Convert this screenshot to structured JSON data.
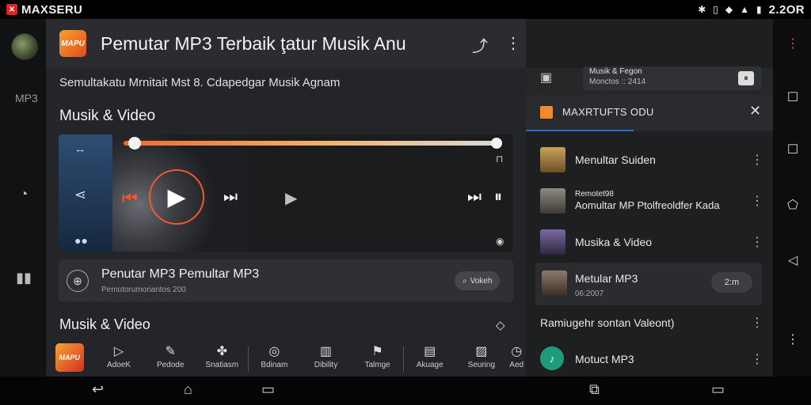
{
  "statusbar": {
    "app_name": "MAXSERU",
    "time": "2.2OR",
    "icons": [
      "bluetooth-icon",
      "vibrate-icon",
      "wifi-icon",
      "signal-icon",
      "battery-icon"
    ]
  },
  "leftrail": {
    "label": "MP3"
  },
  "appbar": {
    "logo_text": "MAPU",
    "title": "Pemutar MP3 Terbaik ţatur Musik Anu"
  },
  "main": {
    "subtitle": "Semultakatu Mrnitait Mst 8. Cdapedgar Musik Agnam",
    "section1": "Musik & Video",
    "section2": "Musik & Video"
  },
  "player": {
    "progress": 0.03
  },
  "now_playing": {
    "title": "Penutar MP3 Pemultar MP3",
    "subtitle": "Pemotorumoriantos 200",
    "chip": "Vokeh"
  },
  "tools": [
    {
      "label": "AdoeK"
    },
    {
      "label": "Pedode"
    },
    {
      "label": "Snatiasm"
    },
    {
      "label": "Bdinam"
    },
    {
      "label": "Dibility"
    },
    {
      "label": "Talmge"
    },
    {
      "label": "Akuage"
    },
    {
      "label": "Seuring"
    },
    {
      "label": "Aed"
    }
  ],
  "drawer": {
    "top_line1": "Musik & Fegon",
    "top_line2": "Monctos :: 2414",
    "head_title": "MAXRTUFTS ODU",
    "items": [
      {
        "title": "Menultar Suiden"
      },
      {
        "title": "Remotet98",
        "sub": "Aomultar MP Ptolfreoldfer Kada"
      },
      {
        "title": "Musika & Video"
      },
      {
        "title": "Metular MP3",
        "sub": "06:2007",
        "chip": "2:m"
      },
      {
        "title": "Ramiugehr sontan Valeont)"
      },
      {
        "title": "Motuct MP3"
      }
    ]
  },
  "colors": {
    "accent": "#f05a2a",
    "panel": "#242528",
    "drawer_underline": "#2a6fd6",
    "green_badge": "#1c9c7a"
  }
}
